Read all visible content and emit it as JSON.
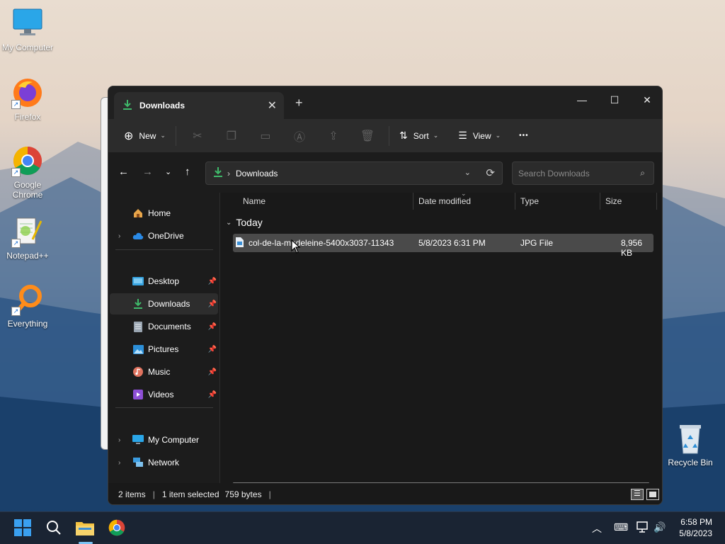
{
  "desktop": {
    "icons": [
      {
        "label": "My Computer"
      },
      {
        "label": "Firefox"
      },
      {
        "label": "Google Chrome"
      },
      {
        "label": "Notepad++"
      },
      {
        "label": "Everything"
      },
      {
        "label": "Recycle Bin"
      }
    ]
  },
  "window": {
    "tab_title": "Downloads",
    "tab_close": "✕",
    "new_tab": "+",
    "controls": {
      "minimize": "—",
      "maximize": "☐",
      "close": "✕"
    },
    "toolbar": {
      "new_label": "New",
      "sort_label": "Sort",
      "view_label": "View",
      "more_label": "•••"
    },
    "address": {
      "crumb": "Downloads",
      "search_placeholder": "Search Downloads"
    },
    "nav": {
      "items": [
        {
          "label": "Home"
        },
        {
          "label": "OneDrive"
        },
        {
          "label": "Desktop"
        },
        {
          "label": "Downloads"
        },
        {
          "label": "Documents"
        },
        {
          "label": "Pictures"
        },
        {
          "label": "Music"
        },
        {
          "label": "Videos"
        },
        {
          "label": "My Computer"
        },
        {
          "label": "Network"
        }
      ]
    },
    "columns": [
      "Name",
      "Date modified",
      "Type",
      "Size"
    ],
    "group": "Today",
    "files": [
      {
        "name": "col-de-la-madeleine-5400x3037-11343",
        "date": "5/8/2023 6:31 PM",
        "type": "JPG File",
        "size": "8,956 KB"
      }
    ],
    "status": {
      "items": "2 items",
      "selected": "1 item selected",
      "size": "759 bytes"
    }
  },
  "taskbar": {
    "time": "6:58 PM",
    "date": "5/8/2023"
  },
  "colors": {
    "accent_download": "#3fb96a",
    "folder_yellow": "#f5c342",
    "window_bg": "#191919"
  }
}
